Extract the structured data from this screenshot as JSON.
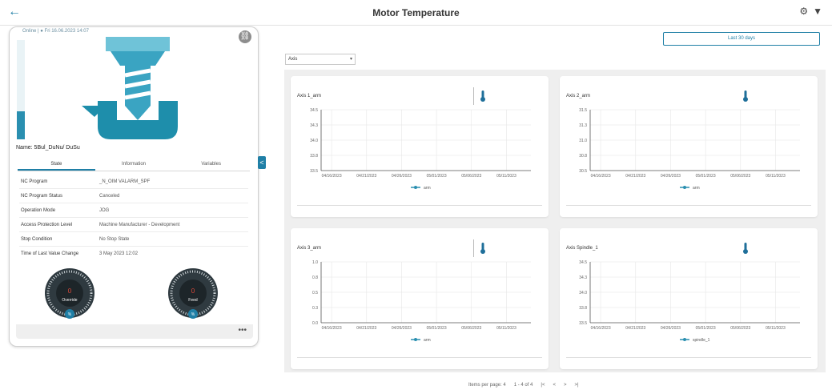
{
  "header": {
    "title": "Motor Temperature",
    "back_icon": "←",
    "gear_icon": "⚙",
    "filter_icon": "▼"
  },
  "machine": {
    "status_text": "Online | ●  Fri 16.06.2023 14:07",
    "name_label": "Name: 5Bul_DuNu/ DuSu",
    "utilization": 0.28,
    "tabs": [
      "State",
      "Information",
      "Variables"
    ],
    "rows": [
      {
        "key": "NC Program",
        "value": "_N_OIM VALARM_SPF"
      },
      {
        "key": "NC Program Status",
        "value": "Canceled"
      },
      {
        "key": "Operation Mode",
        "value": "JOG"
      },
      {
        "key": "Access Protection Level",
        "value": "Machine Manufacturer - Development"
      },
      {
        "key": "Stop Condition",
        "value": "No Stop State"
      },
      {
        "key": "Time of Last Value Change",
        "value": "3 May 2023 12:02"
      }
    ],
    "gauges": [
      {
        "name": "Override",
        "value": "0",
        "unit": "%"
      },
      {
        "name": "Feed",
        "value": "0",
        "unit": "%"
      }
    ],
    "more_label": "•••"
  },
  "controls": {
    "range_label": "Last 30 days",
    "axis_select": "Axis",
    "collapse_icon": "<"
  },
  "panels": [
    {
      "title": "Axis 1_arm",
      "legend": "arm"
    },
    {
      "title": "Axis 2_arm",
      "legend": "arm"
    },
    {
      "title": "Axis 3_arm",
      "legend": "arm"
    },
    {
      "title": "Axis Spindle_1",
      "legend": "spindle_1"
    }
  ],
  "chart_data": [
    {
      "type": "line",
      "title": "Axis 1_arm",
      "x": [
        "04/16/2023",
        "04/21/2023",
        "04/26/2023",
        "05/01/2023",
        "05/06/2023",
        "05/11/2023"
      ],
      "series": [
        {
          "name": "arm",
          "values": []
        }
      ],
      "ylim": [
        33.5,
        34.5
      ]
    },
    {
      "type": "line",
      "title": "Axis 2_arm",
      "x": [
        "04/16/2023",
        "04/21/2023",
        "04/26/2023",
        "05/01/2023",
        "05/06/2023",
        "05/11/2023"
      ],
      "series": [
        {
          "name": "arm",
          "values": []
        }
      ],
      "ylim": [
        30.5,
        31.5
      ]
    },
    {
      "type": "line",
      "title": "Axis 3_arm",
      "x": [
        "04/16/2023",
        "04/21/2023",
        "04/26/2023",
        "05/01/2023",
        "05/06/2023",
        "05/11/2023"
      ],
      "series": [
        {
          "name": "arm",
          "values": []
        }
      ],
      "ylim": [
        0.0,
        1.0
      ]
    },
    {
      "type": "line",
      "title": "Axis Spindle_1",
      "x": [
        "04/16/2023",
        "04/21/2023",
        "04/26/2023",
        "05/01/2023",
        "05/06/2023",
        "05/11/2023"
      ],
      "series": [
        {
          "name": "spindle_1",
          "values": []
        }
      ],
      "ylim": [
        33.5,
        34.5
      ]
    }
  ],
  "pager": {
    "page_size_label": "Items per page: 4",
    "range_label": "1 - 4 of 4"
  },
  "colors": {
    "accent": "#1f7fa6",
    "machine": "#2a9ab8"
  }
}
